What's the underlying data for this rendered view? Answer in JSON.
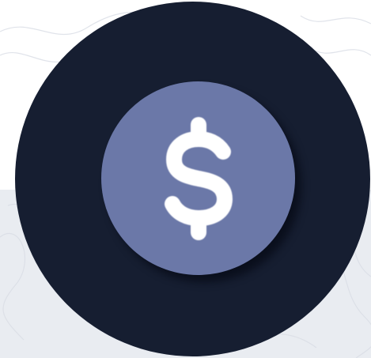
{
  "icon": {
    "name": "dollar-sign-icon",
    "outer_color": "#161e31",
    "inner_color": "#6b78a8",
    "glyph_color": "#ffffff"
  },
  "background": {
    "top_color": "#ffffff",
    "bottom_color": "#e9ecf1"
  }
}
